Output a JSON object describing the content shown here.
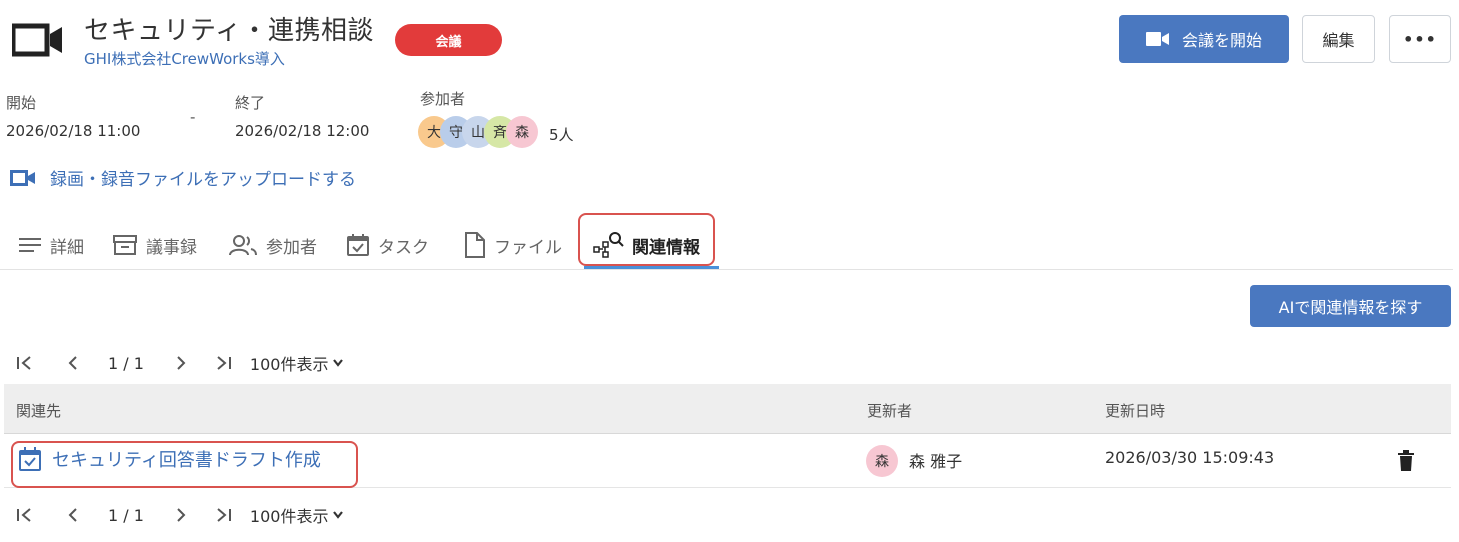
{
  "meeting": {
    "title": "セキュリティ・連携相談",
    "subtitle": "GHI株式会社CrewWorks導入",
    "badge": "会議",
    "start_label": "開始",
    "start_value": "2026/02/18 11:00",
    "separator": "-",
    "end_label": "終了",
    "end_value": "2026/02/18 12:00",
    "participants_label": "参加者",
    "participants": [
      {
        "initial": "大",
        "color": "#f9c98d"
      },
      {
        "initial": "守",
        "color": "#b9cdea"
      },
      {
        "initial": "山",
        "color": "#c8d6ec"
      },
      {
        "initial": "斉",
        "color": "#d6e7a6"
      },
      {
        "initial": "森",
        "color": "#f7c7d2"
      }
    ],
    "participant_count": "5人",
    "upload_link": "録画・録音ファイルをアップロードする"
  },
  "actions": {
    "start_meeting": "会議を開始",
    "edit": "編集",
    "more": "•••"
  },
  "tabs": [
    {
      "label": "詳細",
      "icon": "list-icon",
      "active": false
    },
    {
      "label": "議事録",
      "icon": "archive-icon",
      "active": false
    },
    {
      "label": "参加者",
      "icon": "people-icon",
      "active": false
    },
    {
      "label": "タスク",
      "icon": "calendar-check-icon",
      "active": false
    },
    {
      "label": "ファイル",
      "icon": "file-icon",
      "active": false
    },
    {
      "label": "関連情報",
      "icon": "related-search-icon",
      "active": true
    }
  ],
  "ai_button": "AIで関連情報を探す",
  "pager": {
    "page_text": "1 / 1",
    "page_size": "100件表示"
  },
  "table": {
    "headers": {
      "target": "関連先",
      "updater": "更新者",
      "updated_at": "更新日時"
    },
    "rows": [
      {
        "target": "セキュリティ回答書ドラフト作成",
        "target_icon": "task-calendar-icon",
        "updater_initial": "森",
        "updater": "森 雅子",
        "updated_at": "2026/03/30 15:09:43"
      }
    ]
  },
  "colors": {
    "accent": "#4a78c0",
    "link": "#3d6fb6",
    "badge": "#e23b3b",
    "highlight": "#d9534f",
    "tab_underline": "#4a90d9"
  }
}
